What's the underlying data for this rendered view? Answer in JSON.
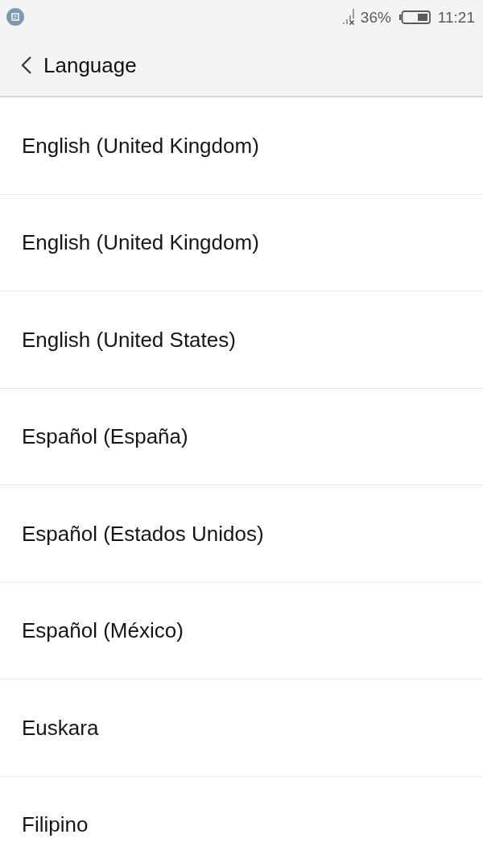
{
  "status_bar": {
    "battery_percent": "36%",
    "time": "11:21"
  },
  "header": {
    "title": "Language"
  },
  "languages": [
    "English (United Kingdom)",
    "English (United Kingdom)",
    "English (United States)",
    "Español (España)",
    "Español (Estados Unidos)",
    "Español (México)",
    "Euskara",
    "Filipino"
  ]
}
